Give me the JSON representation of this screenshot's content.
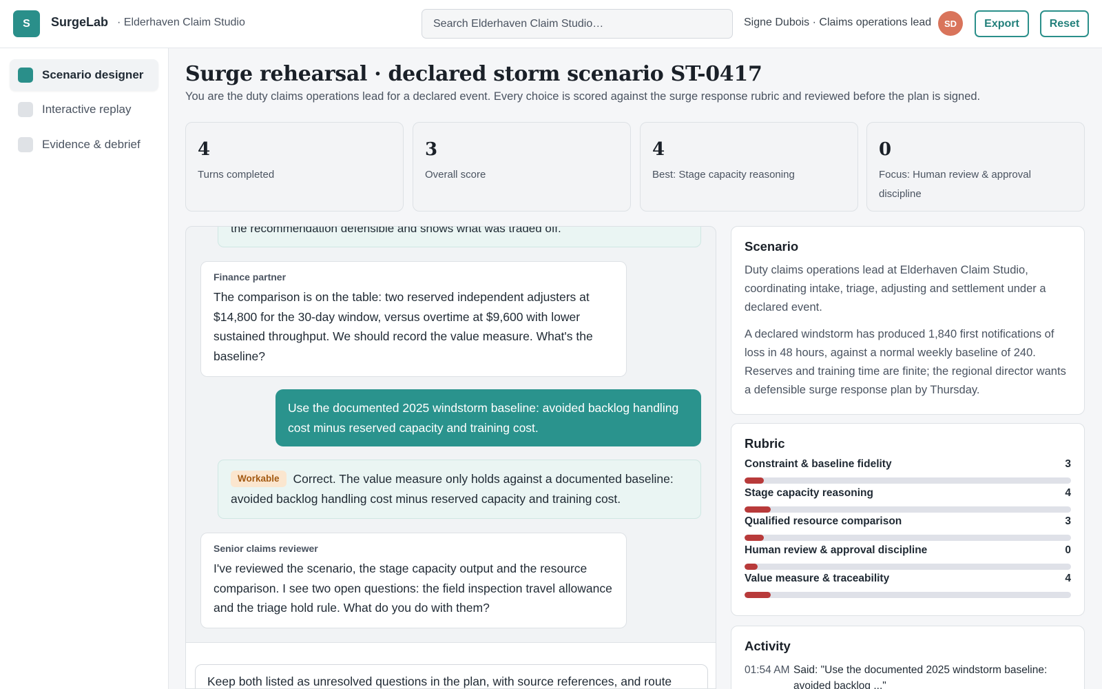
{
  "header": {
    "logo_letter": "S",
    "brand": "SurgeLab",
    "workspace": "· Elderhaven Claim Studio",
    "search_placeholder": "Search Elderhaven Claim Studio…",
    "user": "Signe Dubois · Claims operations lead",
    "avatar_initials": "SD",
    "export_label": "Export",
    "reset_label": "Reset"
  },
  "sidebar": {
    "items": [
      {
        "label": "Scenario designer",
        "active": true
      },
      {
        "label": "Interactive replay",
        "active": false
      },
      {
        "label": "Evidence & debrief",
        "active": false
      }
    ]
  },
  "main": {
    "title": "Surge rehearsal · declared storm scenario ST-0417",
    "subtitle": "You are the duty claims operations lead for a declared event. Every choice is scored against the surge response rubric and reviewed before the plan is signed.",
    "stats": [
      {
        "value": "4",
        "label": "Turns completed"
      },
      {
        "value": "3",
        "label": "Overall score"
      },
      {
        "value": "4",
        "label": "Best: Stage capacity reasoning"
      },
      {
        "value": "0",
        "label": "Focus: Human review & approval discipline"
      }
    ]
  },
  "chat": {
    "partial_top": "the recommendation defensible and shows what was traded off.",
    "messages": [
      {
        "speaker": "Finance partner",
        "text": "The comparison is on the table: two reserved independent adjusters at $14,800 for the 30-day window, versus overtime at $9,600 with lower sustained throughput. We should record the value measure. What's the baseline?"
      },
      {
        "speaker": "You",
        "text": "Use the documented 2025 windstorm baseline: avoided backlog handling cost minus reserved capacity and training cost."
      },
      {
        "speaker": "Assessment",
        "badge": "Workable",
        "text": "Correct. The value measure only holds against a documented baseline: avoided backlog handling cost minus reserved capacity and training cost."
      },
      {
        "speaker": "Senior claims reviewer",
        "text": "I've reviewed the scenario, the stage capacity output and the resource comparison. I see two open questions: the field inspection travel allowance and the triage hold rule. What do you do with them?"
      }
    ],
    "composer_text": "Keep both listed as unresolved questions in the plan, with source references, and route"
  },
  "scenario": {
    "title": "Scenario",
    "role": "Duty claims operations lead at Elderhaven Claim Studio, coordinating intake, triage, adjusting and settlement under a declared event.",
    "situation": "A declared windstorm has produced 1,840 first notifications of loss in 48 hours, against a normal weekly baseline of 240. Reserves and training time are finite; the regional director wants a defensible surge response plan by Thursday."
  },
  "rubric": {
    "title": "Rubric",
    "max_score": 5,
    "bar_color": "#b83a3a",
    "items": [
      {
        "name": "Constraint & baseline fidelity",
        "score": 3
      },
      {
        "name": "Stage capacity reasoning",
        "score": 4
      },
      {
        "name": "Qualified resource comparison",
        "score": 3
      },
      {
        "name": "Human review & approval discipline",
        "score": 0
      },
      {
        "name": "Value measure & traceability",
        "score": 4
      }
    ]
  },
  "activity": {
    "title": "Activity",
    "items": [
      {
        "time": "01:54 AM",
        "text": "Said: \"Use the documented 2025 windstorm baseline: avoided backlog ...\""
      }
    ]
  },
  "colors": {
    "accent": "#2a8f8a",
    "avatar": "#d9745b",
    "badge_bg": "#fbe6cf",
    "badge_text": "#a35a12"
  }
}
